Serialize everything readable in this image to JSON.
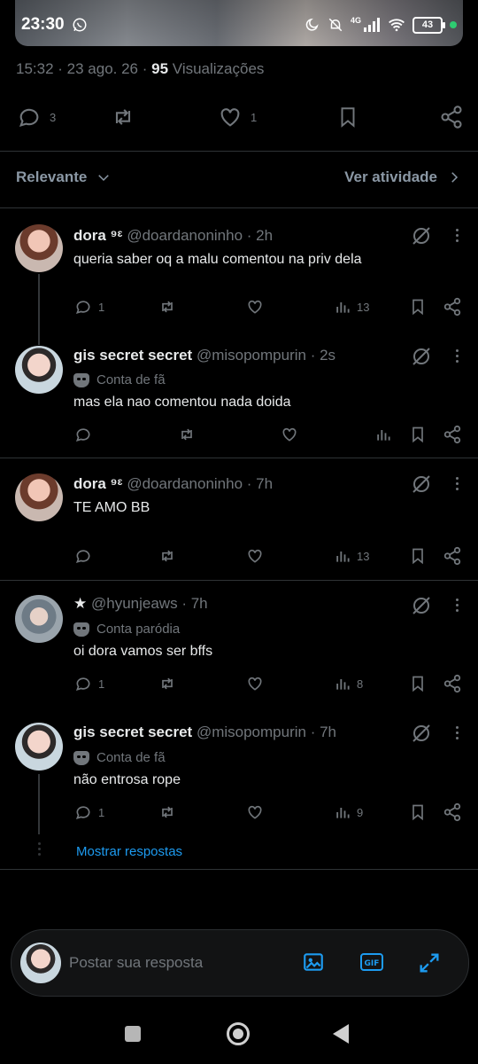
{
  "status_bar": {
    "time": "23:30",
    "network": "4G",
    "battery": "43"
  },
  "post_meta": {
    "time": "15:32",
    "date": "23 ago. 26",
    "views_count": "95",
    "views_label": "Visualizações"
  },
  "post_actions": {
    "replies": "3",
    "likes": "1"
  },
  "filter": {
    "sort_label": "Relevante",
    "activity_label": "Ver atividade"
  },
  "replies": [
    {
      "name": "dora ⁹ᵋ",
      "handle": "@doardanoninho",
      "time": "· 2h",
      "badge": "",
      "text": "queria saber oq a malu comentou na priv dela",
      "replies": "1",
      "views": "13"
    },
    {
      "name": "gis secret secret",
      "handle": "@misopompurin",
      "time": "· 2s",
      "badge": "Conta de fã",
      "text": "mas ela nao comentou nada doida",
      "replies": "",
      "views": ""
    },
    {
      "name": "dora ⁹ᵋ",
      "handle": "@doardanoninho",
      "time": "· 7h",
      "badge": "",
      "text": "TE AMO BB",
      "replies": "",
      "views": "13"
    },
    {
      "name": "★",
      "handle": "@hyunjeaws",
      "time": "· 7h",
      "badge": "Conta paródia",
      "text": "oi dora vamos ser bffs",
      "replies": "1",
      "views": "8"
    },
    {
      "name": "gis secret secret",
      "handle": "@misopompurin",
      "time": "· 7h",
      "badge": "Conta de fã",
      "text": "não entrosa rope",
      "replies": "1",
      "views": "9"
    }
  ],
  "show_replies": "Mostrar respostas",
  "composer": {
    "placeholder": "Postar sua resposta"
  },
  "colors": {
    "accent": "#1d9bf0",
    "muted": "#71767b",
    "background": "#000000"
  }
}
